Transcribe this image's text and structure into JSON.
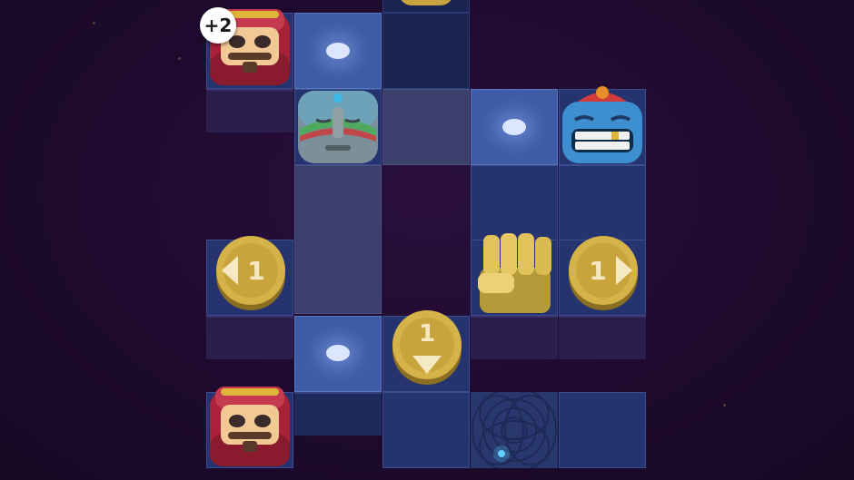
{
  "game": {
    "level_board": {
      "bonus_badge": "+2",
      "tokens": [
        {
          "type": "merchant-king",
          "role": "player-piece"
        },
        {
          "type": "stone-sage-mask"
        },
        {
          "type": "blue-grinning-mask"
        },
        {
          "type": "arrow-coin",
          "direction": "left",
          "value": "1"
        },
        {
          "type": "fist-block"
        },
        {
          "type": "arrow-coin",
          "direction": "right",
          "value": "1"
        },
        {
          "type": "arrow-coin",
          "direction": "down",
          "value": "1"
        },
        {
          "type": "merchant-king",
          "role": "goal-piece"
        },
        {
          "type": "portal"
        }
      ],
      "markers": [
        "glow-dot",
        "glow-dot",
        "glow-dot"
      ]
    },
    "colors": {
      "background": "#1e0a2e",
      "tile": "#25336e",
      "tile_light": "#3e5ba6",
      "gold": "#d4b048",
      "dot": "#dde6ff"
    }
  }
}
